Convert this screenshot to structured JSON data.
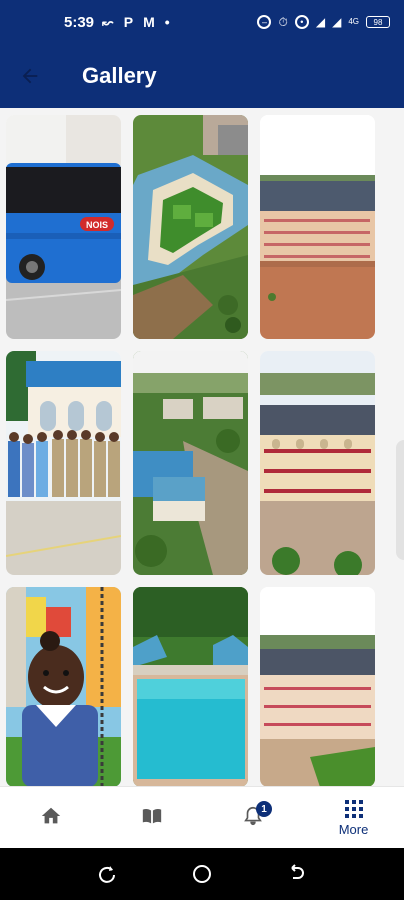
{
  "status_bar": {
    "time": "5:39",
    "left_glyphs": [
      "P",
      "M"
    ],
    "network_label": "4G",
    "battery": "98"
  },
  "app_bar": {
    "title": "Gallery",
    "back_icon": "arrow-left-icon"
  },
  "gallery": {
    "bus_label": "NOIS",
    "photos": [
      {
        "subject": "blue school bus"
      },
      {
        "subject": "aerial view of quadrangle with green roofs"
      },
      {
        "subject": "multi-storey building with red courtyard"
      },
      {
        "subject": "pupils in uniform in front of building"
      },
      {
        "subject": "aerial view of campus with blue roofs"
      },
      {
        "subject": "cream building with red railings"
      },
      {
        "subject": "smiling child on playground swing"
      },
      {
        "subject": "outdoor swimming pool with gazebos"
      },
      {
        "subject": "multi-storey building with green lawn"
      }
    ]
  },
  "bottom_nav": {
    "items": [
      {
        "icon": "home-icon",
        "label": ""
      },
      {
        "icon": "book-icon",
        "label": ""
      },
      {
        "icon": "bell-icon",
        "label": "",
        "badge": "1"
      },
      {
        "icon": "grid-icon",
        "label": "More"
      }
    ]
  },
  "colors": {
    "primary": "#0d2f78",
    "background": "#f4f4f4"
  }
}
